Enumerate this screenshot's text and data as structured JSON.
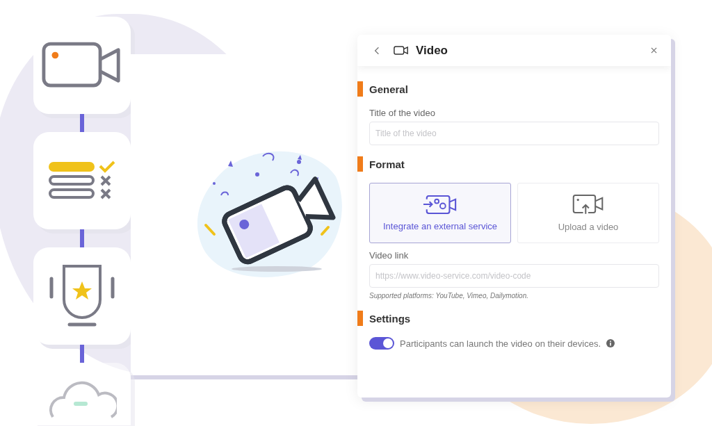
{
  "steps": [
    {
      "kind": "video"
    },
    {
      "kind": "quiz"
    },
    {
      "kind": "trophy"
    },
    {
      "kind": "cloud"
    }
  ],
  "panel": {
    "title": "Video",
    "sections": [
      {
        "heading": "General",
        "fields": [
          {
            "label": "Title of the video",
            "placeholder": "Title of the video"
          }
        ]
      },
      {
        "heading": "Format",
        "options": [
          {
            "kind": "integrate",
            "label": "Integrate an external service",
            "selected": true
          },
          {
            "kind": "upload",
            "label": "Upload a video",
            "selected": false
          }
        ],
        "fields": [
          {
            "label": "Video link",
            "placeholder": "https://www.video-service.com/video-code",
            "hint": "Supported platforms: YouTube, Vimeo, Dailymotion."
          }
        ]
      },
      {
        "heading": "Settings",
        "toggles": [
          {
            "label": "Participants can launch the video on their devices.",
            "on": true
          }
        ]
      }
    ]
  }
}
